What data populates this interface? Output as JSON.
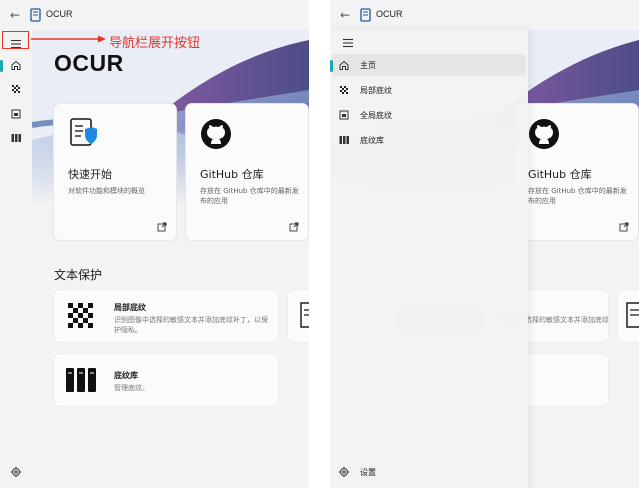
{
  "app": {
    "title": "OCUR"
  },
  "annotation": {
    "text": "导航栏展开按钮",
    "color": "#e8352a"
  },
  "main": {
    "heading": "OCUR",
    "cards": [
      {
        "title": "快速开始",
        "description": "对软件功能和模块的概览"
      },
      {
        "title": "GitHub 仓库",
        "description_line1": "存放在 GitHub 仓库中的最新发",
        "description_line2": "布的应用"
      }
    ],
    "section_title": "文本保护",
    "modules": [
      {
        "title": "局部底纹",
        "description_line1": "识别图像中选择的敏感文本并添加底纹补丁，以保",
        "description_line2": "护隐私。"
      },
      {
        "title": "底纹库",
        "description": "管理底纹。"
      }
    ]
  },
  "nav": {
    "items": [
      {
        "label": "主页",
        "icon": "home-icon"
      },
      {
        "label": "局部底纹",
        "icon": "checker-icon"
      },
      {
        "label": "全局底纹",
        "icon": "image-icon"
      },
      {
        "label": "底纹库",
        "icon": "library-icon"
      }
    ],
    "settings_label": "设置"
  },
  "colors": {
    "accent": "#1aa6b1",
    "annotation": "#e8352a"
  }
}
